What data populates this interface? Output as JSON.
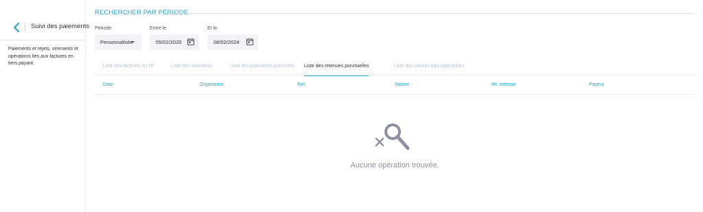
{
  "sidebar": {
    "title": "Suivi des paiements",
    "description": "Paiements et rejets, virements et opérations liés aux factures en tiers payant."
  },
  "search": {
    "section_title": "RECHERCHER PAR PÉRIODE",
    "period_label": "Période",
    "period_value": "Personnalisée",
    "from_label": "Entre le",
    "from_value": "05/02/2020",
    "to_label": "Et le",
    "to_value": "08/02/2024"
  },
  "tabs": [
    {
      "label": "Liste des factures en TP",
      "active": false
    },
    {
      "label": "Liste des virements",
      "active": false
    },
    {
      "label": "Liste des paiements ponctuels",
      "active": false
    },
    {
      "label": "Liste des retenues ponctuelles",
      "active": true
    },
    {
      "label": "Liste des retours non rapprochés",
      "active": false
    }
  ],
  "table": {
    "columns": [
      "Date",
      "Organisme",
      "Ref",
      "Nature",
      "Mt. retenue",
      "Payeur"
    ]
  },
  "empty_state": {
    "icon": "search-no-result-icon",
    "message": "Aucune opération trouvée."
  },
  "colors": {
    "accent": "#29a3c6",
    "tab_inactive": "#b8bfd0",
    "field_bg": "#f3f3f6",
    "empty_text": "#8e8fa0"
  }
}
